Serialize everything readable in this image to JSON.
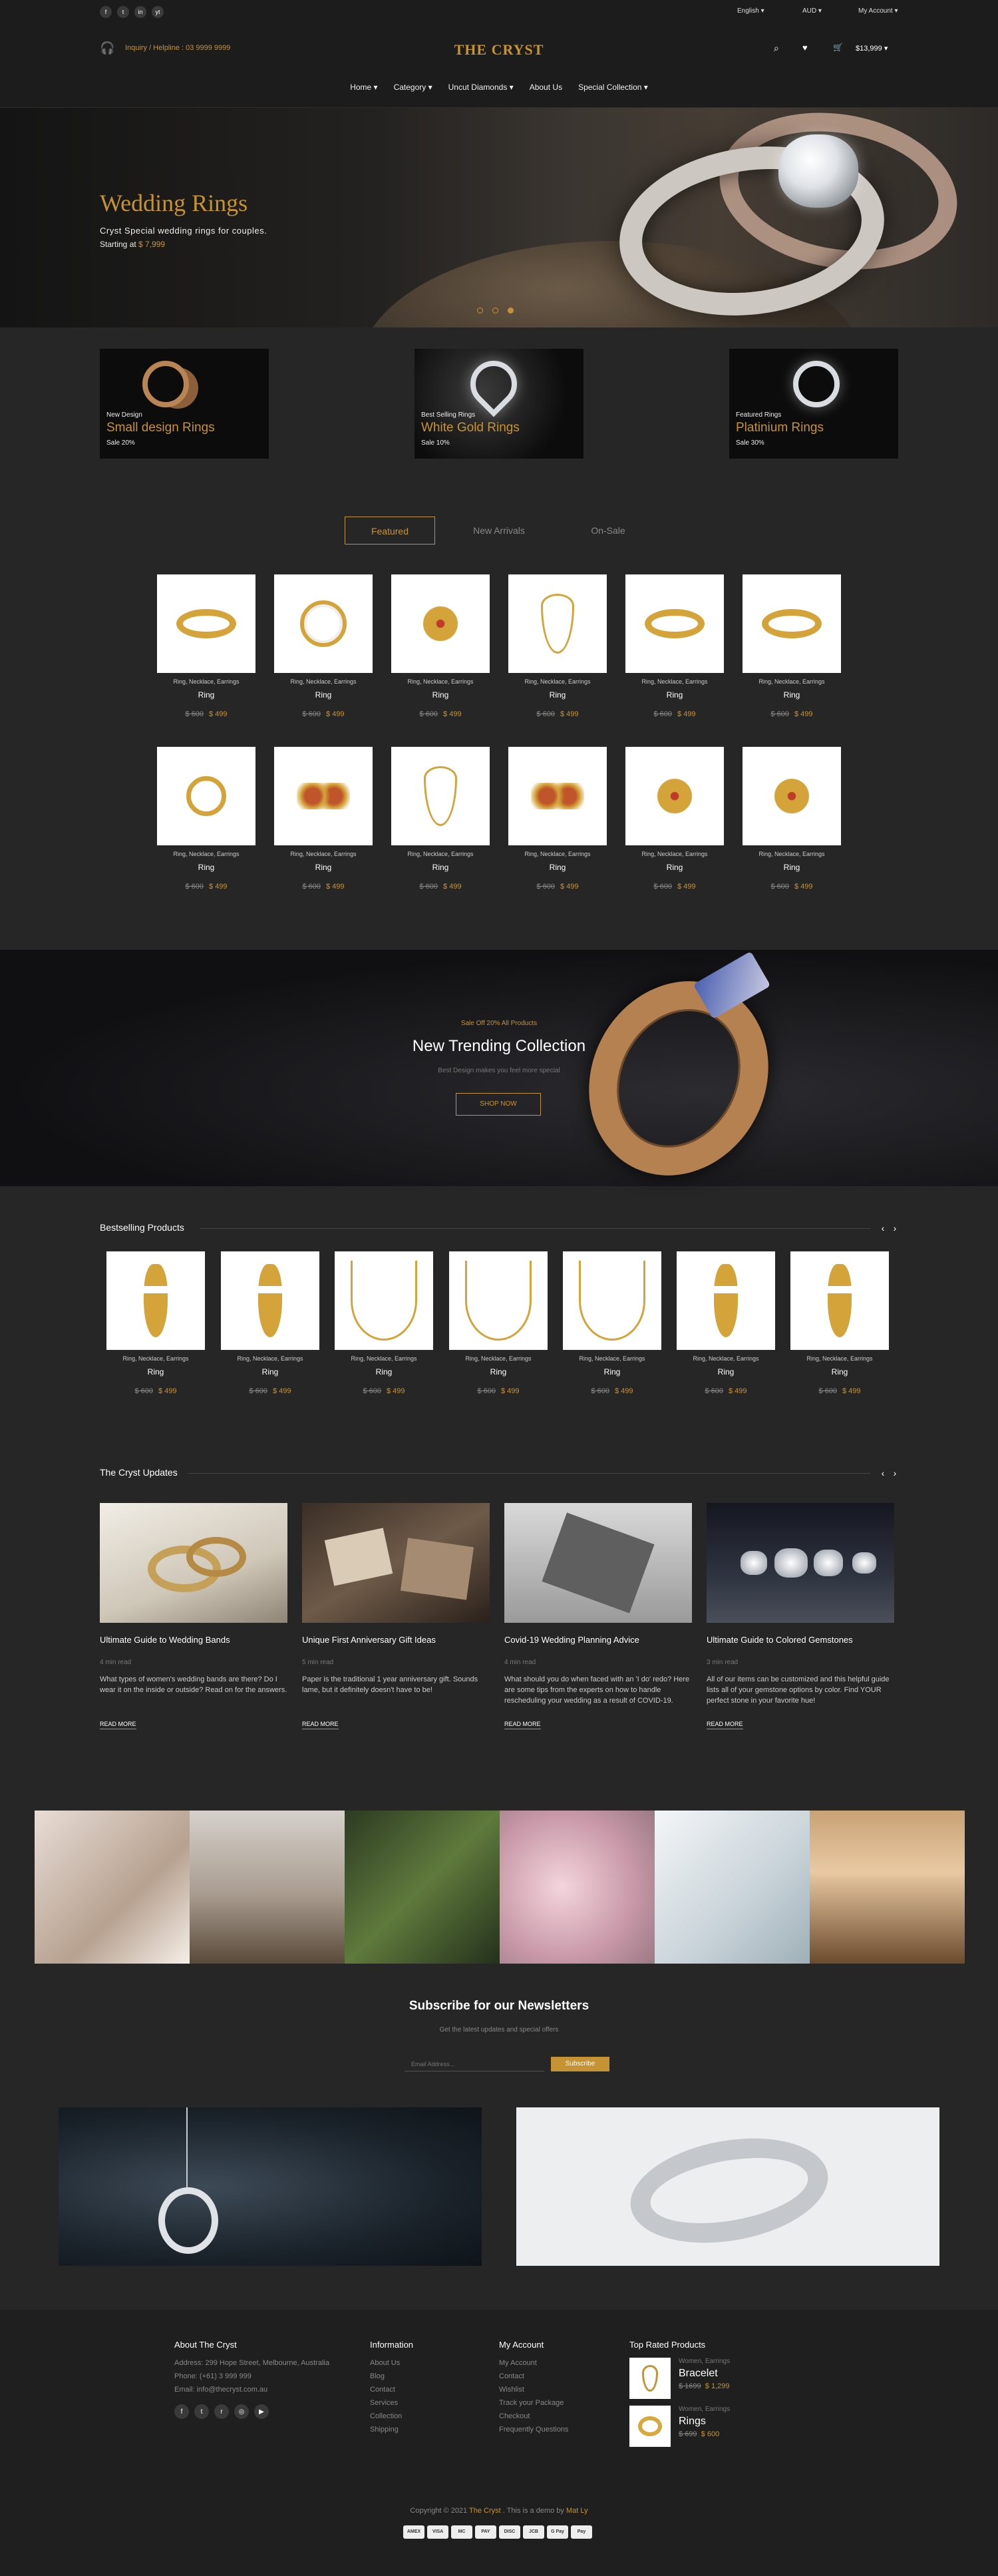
{
  "topbar": {
    "social": [
      "f",
      "t",
      "in",
      "yt"
    ],
    "language": "English",
    "currency": "AUD",
    "account": "My Account"
  },
  "header": {
    "helpline": "Inquiry / Helpline : 03 9999 9999",
    "logo": "THE CRYST",
    "cart_total": "$13,999"
  },
  "nav": [
    "Home",
    "Category",
    "Uncut Diamonds",
    "About Us",
    "Special Collection"
  ],
  "hero": {
    "title": "Wedding Rings",
    "subtitle": "Cryst Special wedding rings for couples.",
    "price_label": "Starting at",
    "price": "$ 7,999"
  },
  "promos": [
    {
      "small": "New Design",
      "title": "Small design Rings",
      "sale": "Sale 20%"
    },
    {
      "small": "Best Selling Rings",
      "title": "White Gold Rings",
      "sale": "Sale 10%"
    },
    {
      "small": "Featured Rings",
      "title": "Platinium Rings",
      "sale": "Sale 30%"
    }
  ],
  "tabs": [
    "Featured",
    "New Arrivals",
    "On-Sale"
  ],
  "product_common": {
    "category": "Ring, Necklace, Earrings",
    "name": "Ring",
    "old_price": "$ 600",
    "price": "$ 499"
  },
  "banner": {
    "eyebrow": "Sale Off 20% All Products",
    "title": "New Trending Collection",
    "subtitle": "Best Design makes you feel more special",
    "button": "SHOP NOW"
  },
  "bestselling": {
    "title": "Bestselling Products"
  },
  "updates": {
    "title": "The Cryst Updates",
    "posts": [
      {
        "title": "Ultimate Guide to Wedding Bands",
        "time": "4 min read",
        "excerpt": "What types of women's wedding bands are there? Do I wear it on the inside or outside? Read on for the answers.",
        "read": "READ MORE"
      },
      {
        "title": "Unique First Anniversary Gift Ideas",
        "time": "5 min read",
        "excerpt": "Paper is the traditional 1 year anniversary gift. Sounds lame, but it definitely doesn't have to be!",
        "read": "READ MORE"
      },
      {
        "title": "Covid-19 Wedding Planning Advice",
        "time": "4 min read",
        "excerpt": "What should you do when faced with an 'I do' redo? Here are some tips from the experts on how to handle rescheduling your wedding as a result of COVID-19.",
        "read": "READ MORE"
      },
      {
        "title": "Ultimate Guide to Colored Gemstones",
        "time": "3 min read",
        "excerpt": "All of our items can be customized and this helpful guide lists all of your gemstone options by color. Find YOUR perfect stone in your favorite hue!",
        "read": "READ MORE"
      }
    ]
  },
  "newsletter": {
    "title": "Subscribe for our Newsletters",
    "subtitle": "Get the latest updates and special offers",
    "placeholder": "Email Address...",
    "button": "Subscribe"
  },
  "footer": {
    "about": {
      "title": "About The Cryst",
      "address": "Address: 299 Hope Street, Melbourne, Australia",
      "phone": "Phone: (+61) 3 999 999",
      "email": "Email: info@thecryst.com.au"
    },
    "information": {
      "title": "Information",
      "links": [
        "About Us",
        "Blog",
        "Contact",
        "Services",
        "Collection",
        "Shipping"
      ]
    },
    "account": {
      "title": "My Account",
      "links": [
        "My Account",
        "Contact",
        "Wishlist",
        "Track your Package",
        "Checkout",
        "Frequently Questions"
      ]
    },
    "top_rated": {
      "title": "Top Rated Products",
      "items": [
        {
          "cat": "Women, Earrings",
          "name": "Bracelet",
          "old": "$ 1699",
          "price": "$ 1,299"
        },
        {
          "cat": "Women, Earrings",
          "name": "Rings",
          "old": "$ 699",
          "price": "$ 600"
        }
      ]
    },
    "copyright_pre": "Copyright © 2021",
    "copyright_brand": "The Cryst",
    "copyright_mid": ". This is a demo by",
    "copyright_author": "Mat Ly",
    "payments": [
      "AMEX",
      "VISA",
      "MC",
      "PAY",
      "DISC",
      "JCB",
      "G Pay",
      "Pay"
    ]
  }
}
